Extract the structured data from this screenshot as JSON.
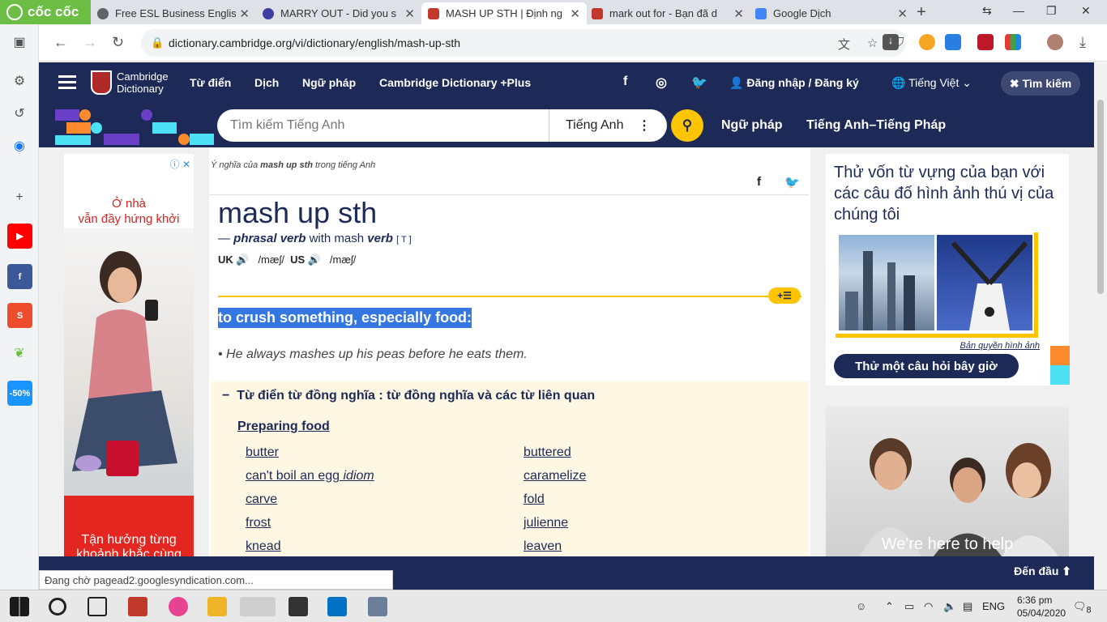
{
  "browser": {
    "brand": "cốc cốc",
    "tabs": [
      {
        "title": "Free ESL Business Englis",
        "color": "#5f6368"
      },
      {
        "title": "MARRY OUT - Did you s",
        "color": "#3c3fa0"
      },
      {
        "title": "MASH UP STH | Định ng",
        "color": "#c0392b"
      },
      {
        "title": "mark out for - Bạn đã d",
        "color": "#c0392b"
      },
      {
        "title": "Google Dịch",
        "color": "#4285f4"
      }
    ],
    "url": "dictionary.cambridge.org/vi/dictionary/english/mash-up-sth"
  },
  "header": {
    "logo_line1": "Cambridge",
    "logo_line2": "Dictionary",
    "nav": [
      "Từ điển",
      "Dịch",
      "Ngữ pháp",
      "Cambridge Dictionary +Plus"
    ],
    "login": "Đăng nhập / Đăng ký",
    "language": "Tiếng Việt",
    "search_toggle": "Tìm kiếm"
  },
  "searchbar": {
    "placeholder": "Tìm kiếm Tiếng Anh",
    "dict": "Tiếng Anh",
    "links": [
      "Ngữ pháp",
      "Tiếng Anh–Tiếng Pháp"
    ]
  },
  "ad_left": {
    "line1": "Ở nhà",
    "line2": "vẫn đầy hứng khởi",
    "bottom": "Tận hưởng từng khoảnh khắc cùng"
  },
  "entry": {
    "breadcrumb_pre": "Ý nghĩa của",
    "breadcrumb_word": "mash up sth",
    "breadcrumb_post": "trong tiếng Anh",
    "headword": "mash up sth",
    "pos_dash": "—",
    "pos": "phrasal verb",
    "with": "with mash",
    "verb": "verb",
    "grammar": "[ T ]",
    "uk": "UK",
    "uk_ipa": "/mæʃ/",
    "us": "US",
    "us_ipa": "/mæʃ/",
    "definition": "to crush something, especially food:",
    "example": "He always mashes up his peas before he eats them."
  },
  "thesaurus": {
    "heading": "Từ điển từ đồng nghĩa : từ đồng nghĩa và các từ liên quan",
    "subheading": "Preparing food",
    "col1": [
      "butter",
      "can't boil an egg",
      "carve",
      "frost",
      "knead"
    ],
    "col1_idiom": [
      "",
      "idiom",
      "",
      "",
      ""
    ],
    "col2": [
      "buttered",
      "caramelize",
      "fold",
      "julienne",
      "leaven"
    ]
  },
  "quiz": {
    "heading": "Thử vốn từ vựng của bạn với các câu đố hình ảnh thú vị của chúng tôi",
    "credit": "Bản quyền hình ảnh",
    "button": "Thử một câu hỏi bây giờ"
  },
  "ad_right": {
    "text": "We're here to help"
  },
  "bottom": {
    "to_top": "Đến đầu"
  },
  "status": "Đang chờ pagead2.googlesyndication.com...",
  "taskbar": {
    "lang": "ENG",
    "time": "6:36 pm",
    "date": "05/04/2020",
    "notif": "8"
  },
  "colors": {
    "brand_navy": "#1d2a57",
    "brand_yellow": "#fec400",
    "highlight": "#3477e0",
    "thesaurus_bg": "#fef7e3"
  }
}
